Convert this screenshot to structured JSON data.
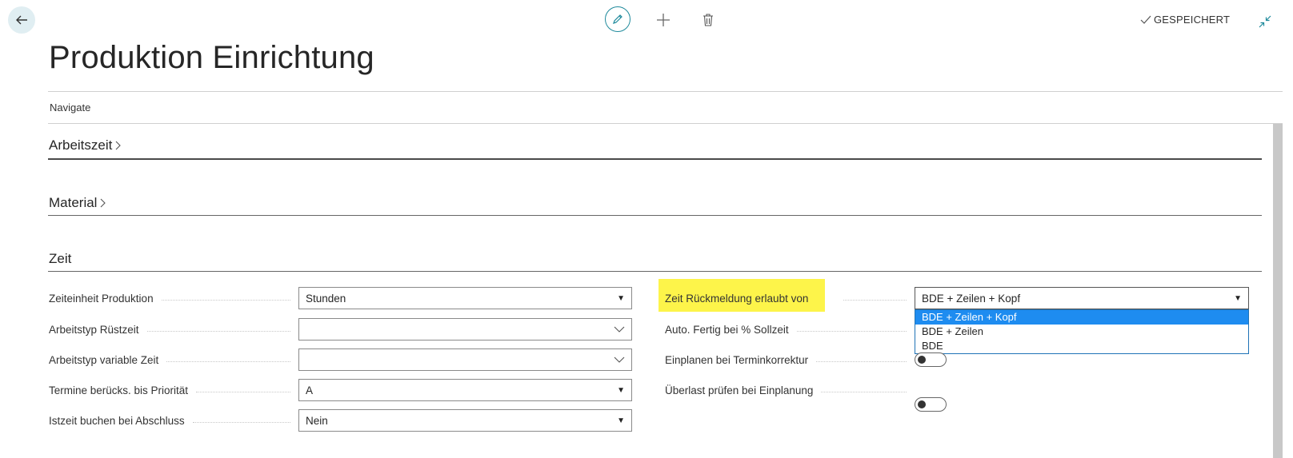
{
  "toolbar": {
    "back_label": "Back",
    "saved_label": "GESPEICHERT"
  },
  "page": {
    "title": "Produktion Einrichtung",
    "navigate_label": "Navigate"
  },
  "sections": {
    "arbeitszeit": "Arbeitszeit",
    "material": "Material",
    "zeit": "Zeit"
  },
  "left_fields": [
    {
      "label": "Zeiteinheit Produktion",
      "value": "Stunden",
      "kind": "select"
    },
    {
      "label": "Arbeitstyp Rüstzeit",
      "value": "",
      "kind": "lookup"
    },
    {
      "label": "Arbeitstyp variable Zeit",
      "value": "",
      "kind": "lookup"
    },
    {
      "label": "Termine berücks. bis Priorität",
      "value": "A",
      "kind": "select"
    },
    {
      "label": "Istzeit buchen bei Abschluss",
      "value": "Nein",
      "kind": "select"
    }
  ],
  "right_fields": [
    {
      "label": "Zeit Rückmeldung erlaubt von",
      "value": "BDE + Zeilen + Kopf",
      "kind": "select"
    },
    {
      "label": "Auto. Fertig bei % Sollzeit",
      "value": "",
      "kind": "input"
    },
    {
      "label": "Einplanen bei Terminkorrektur",
      "value": "off",
      "kind": "toggle"
    },
    {
      "label": "Überlast prüfen bei Einplanung",
      "value": "off",
      "kind": "toggle"
    }
  ],
  "dropdown": {
    "options": [
      "BDE + Zeilen + Kopf",
      "BDE + Zeilen",
      "BDE"
    ],
    "selected": "BDE + Zeilen + Kopf"
  },
  "colors": {
    "accent": "#1f8a9c",
    "highlight": "#fdf44a",
    "dropdown_selected": "#1e8cf0"
  }
}
